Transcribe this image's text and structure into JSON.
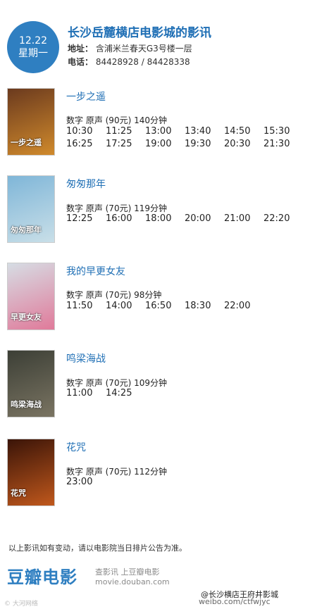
{
  "header": {
    "date": "12.22",
    "weekday": "星期一",
    "cinema": "长沙岳麓横店电影城的影讯",
    "address_label": "地址：",
    "address": "含浦米兰春天G3号楼一层",
    "phone_label": "电话：",
    "phone": "84428928 / 84428338"
  },
  "movies": [
    {
      "title": "一步之遥",
      "meta": "数字  原声  (90元)  140分钟",
      "poster_text": "一步之遥",
      "poster_colors": [
        "#6b3a1e",
        "#d08a2c"
      ],
      "times": [
        [
          "10:30",
          "11:25",
          "13:00",
          "13:40",
          "14:50",
          "15:30"
        ],
        [
          "16:25",
          "17:25",
          "19:00",
          "19:30",
          "20:30",
          "21:30"
        ]
      ]
    },
    {
      "title": "匆匆那年",
      "meta": "数字  原声  (70元)  119分钟",
      "poster_text": "匆匆那年",
      "poster_colors": [
        "#7fb6d8",
        "#c9dfe8"
      ],
      "times": [
        [
          "12:25",
          "16:00",
          "18:00",
          "20:00",
          "21:00",
          "22:20"
        ]
      ]
    },
    {
      "title": "我的早更女友",
      "meta": "数字  原声  (70元)  98分钟",
      "poster_text": "早更女友",
      "poster_colors": [
        "#d6dde4",
        "#e07a9a"
      ],
      "times": [
        [
          "11:50",
          "14:00",
          "16:50",
          "18:30",
          "22:00"
        ]
      ]
    },
    {
      "title": "鸣梁海战",
      "meta": "数字  原声  (70元)  109分钟",
      "poster_text": "鸣梁海战",
      "poster_colors": [
        "#3c3f36",
        "#7a7462"
      ],
      "times": [
        [
          "11:00",
          "14:25"
        ]
      ]
    },
    {
      "title": "花咒",
      "meta": "数字  原声  (70元)  112分钟",
      "poster_text": "花咒",
      "poster_colors": [
        "#3a1408",
        "#c0581c"
      ],
      "times": [
        [
          "23:00"
        ]
      ]
    }
  ],
  "footer": {
    "note": "以上影讯如有变动，请以电影院当日排片公告为准。",
    "brand": "豆瓣电影",
    "brand_sub1": "查影讯  上豆瓣电影",
    "brand_sub2": "movie.douban.com",
    "watermark_left": "© 大河网络",
    "watermark_right": "@长沙横店王府井影城",
    "watermark_right2": "weibo.com/ctfwjyc"
  }
}
